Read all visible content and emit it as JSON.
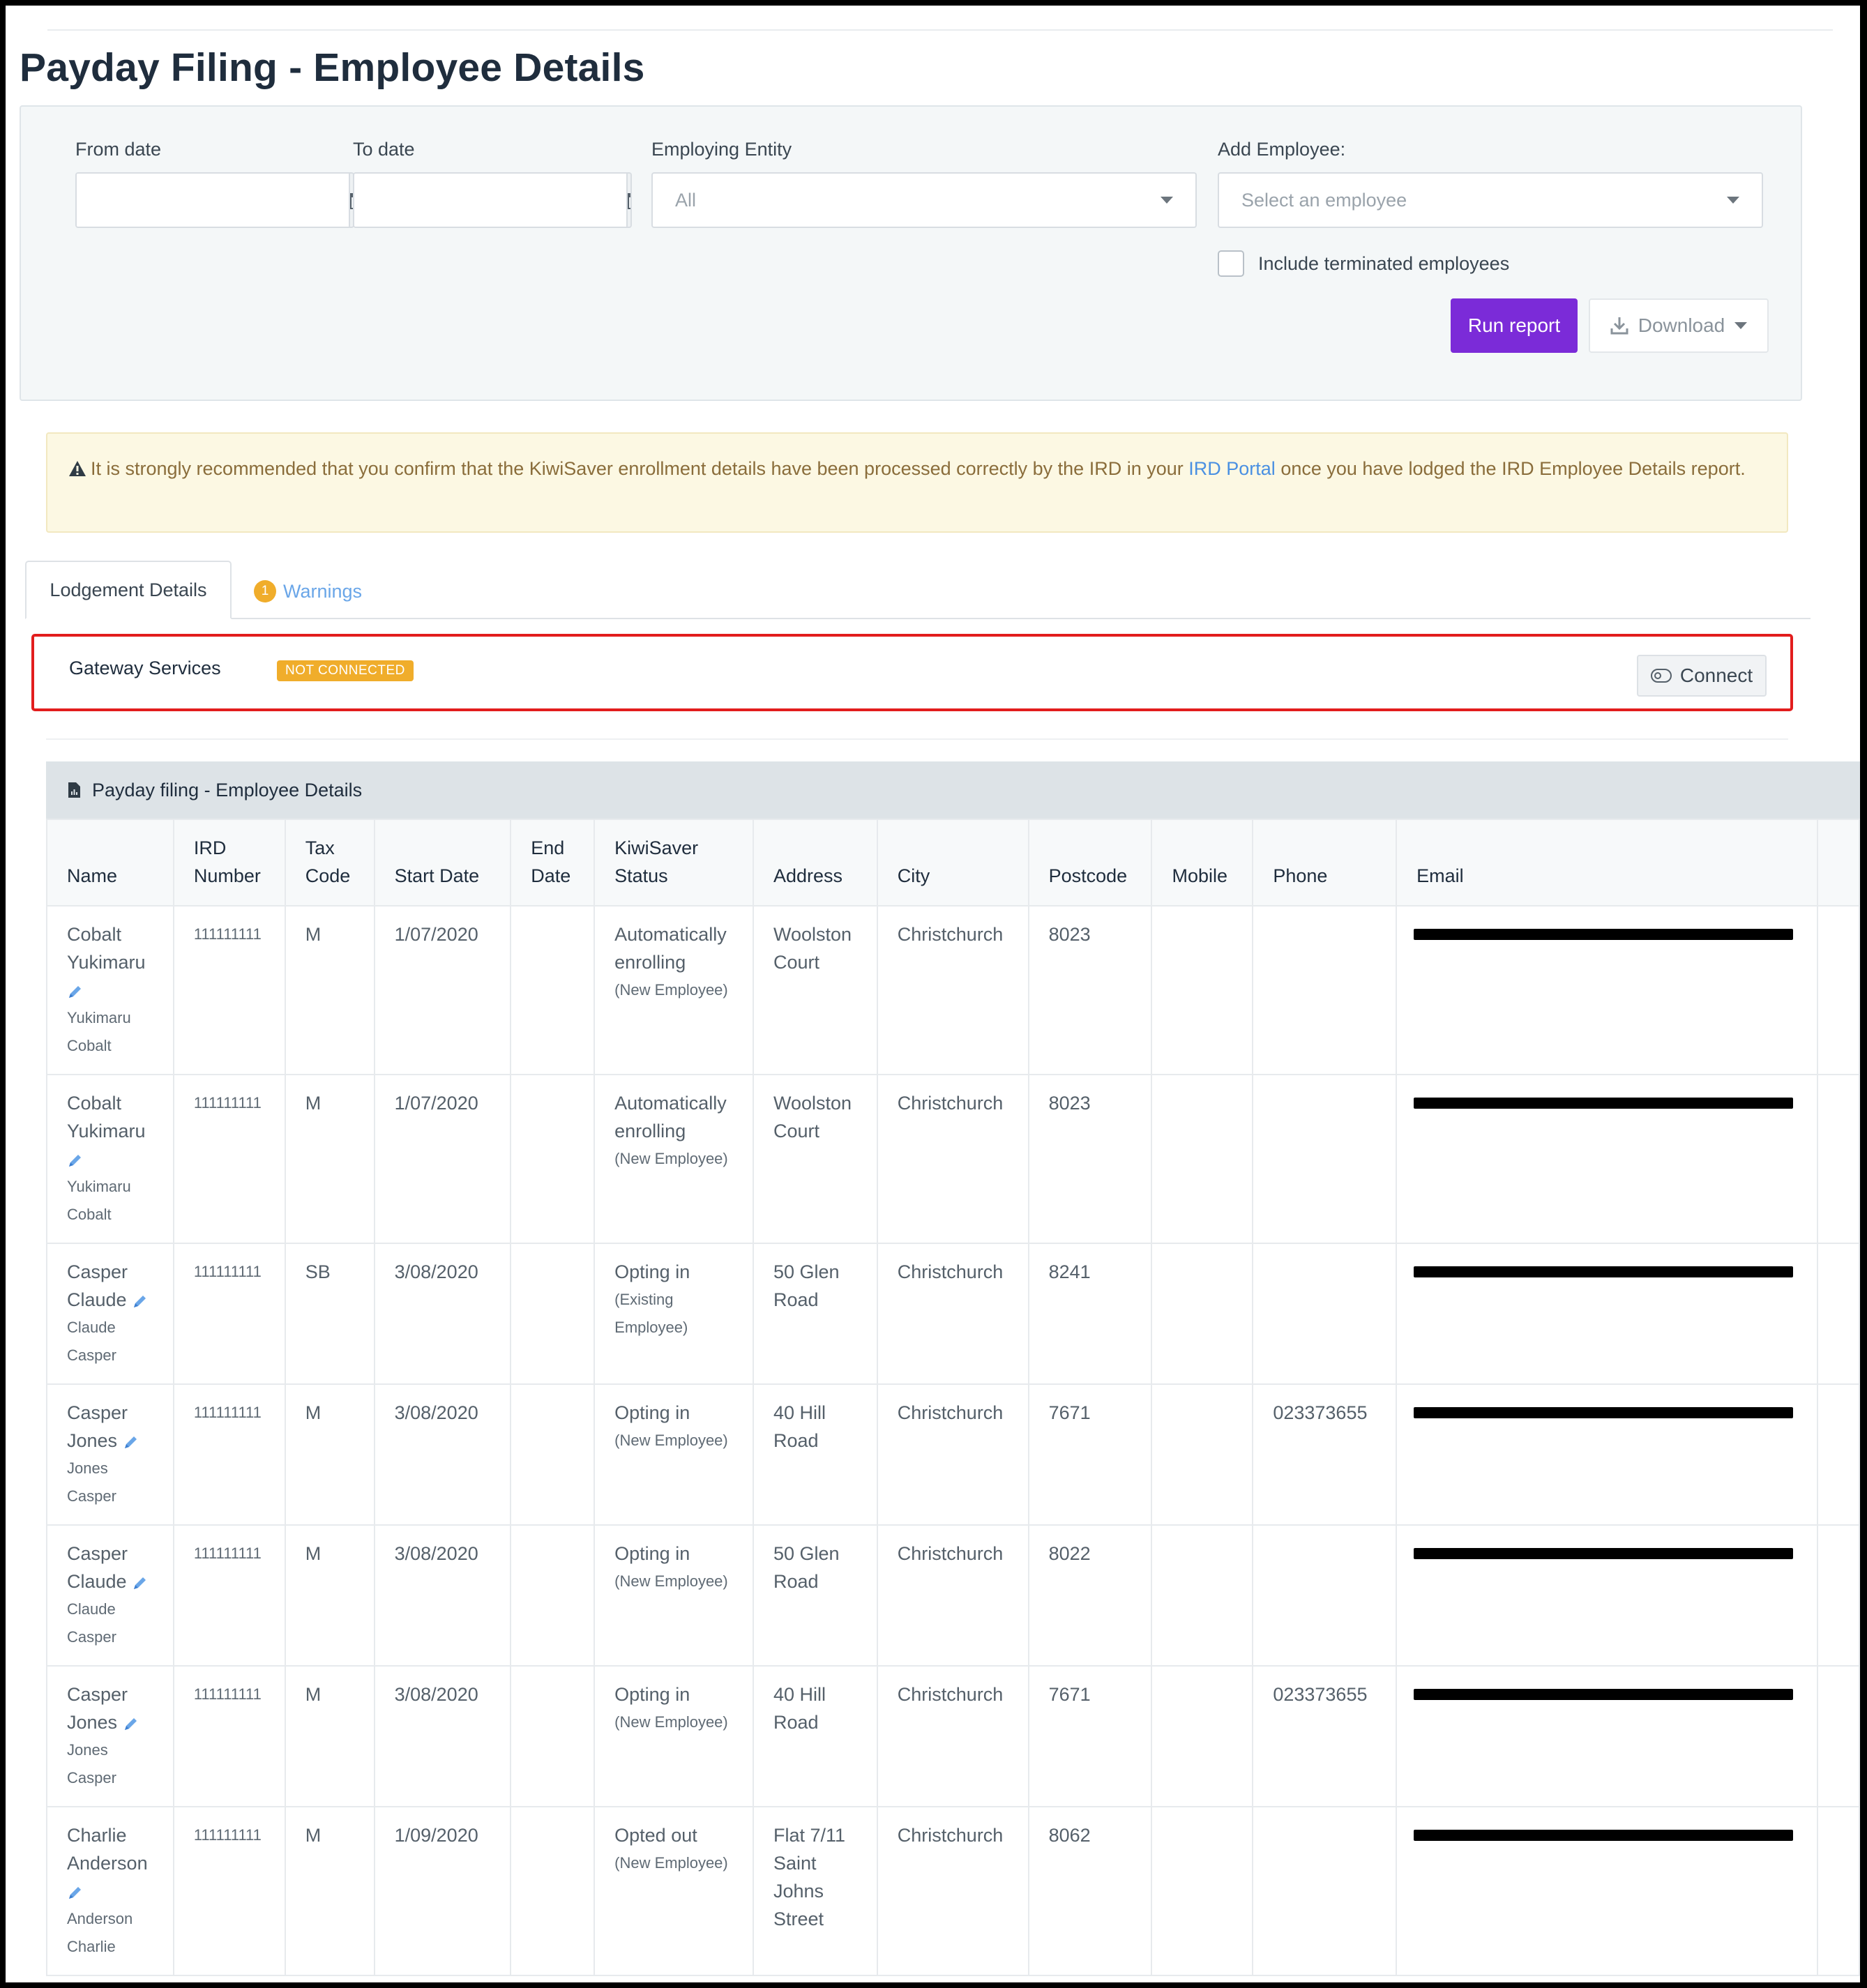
{
  "page": {
    "title": "Payday Filing - Employee Details"
  },
  "filters": {
    "from_label": "From date",
    "from_value": "",
    "to_label": "To date",
    "to_value": "",
    "entity_label": "Employing Entity",
    "entity_value": "All",
    "employee_label": "Add Employee:",
    "employee_placeholder": "Select an employee",
    "include_terminated_label": "Include terminated employees",
    "include_terminated_checked": false,
    "run_label": "Run report",
    "download_label": "Download",
    "accent_color": "#7b2bd8"
  },
  "alert": {
    "text_before": "It is strongly recommended that you confirm that the KiwiSaver enrollment details have been processed correctly by the IRD in your",
    "link_text": "IRD Portal",
    "text_after": "once you have lodged the IRD Employee Details report."
  },
  "tabs": {
    "lodgement": "Lodgement Details",
    "warnings": "Warnings",
    "warnings_count": "1"
  },
  "gateway": {
    "title": "Gateway Services",
    "status": "NOT CONNECTED",
    "connect_label": "Connect"
  },
  "report": {
    "title": "Payday filing - Employee Details",
    "columns": {
      "name": "Name",
      "ird": "IRD Number",
      "tax": "Tax Code",
      "start": "Start Date",
      "end": "End Date",
      "kiwi": "KiwiSaver Status",
      "address": "Address",
      "city": "City",
      "postcode": "Postcode",
      "mobile": "Mobile",
      "phone": "Phone",
      "email": "Email"
    },
    "rows": [
      {
        "name": "Cobalt Yukimaru",
        "alt": "Yukimaru Cobalt",
        "ird": "111111111",
        "tax": "M",
        "start": "1/07/2020",
        "end": "",
        "kiwi": "Automatically enrolling",
        "kiwi_note": "(New Employee)",
        "address": "Woolston Court",
        "city": "Christchurch",
        "postcode": "8023",
        "mobile": "",
        "phone": ""
      },
      {
        "name": "Cobalt Yukimaru",
        "alt": "Yukimaru Cobalt",
        "ird": "111111111",
        "tax": "M",
        "start": "1/07/2020",
        "end": "",
        "kiwi": "Automatically enrolling",
        "kiwi_note": "(New Employee)",
        "address": "Woolston Court",
        "city": "Christchurch",
        "postcode": "8023",
        "mobile": "",
        "phone": ""
      },
      {
        "name": "Casper Claude",
        "alt": "Claude Casper",
        "ird": "111111111",
        "tax": "SB",
        "start": "3/08/2020",
        "end": "",
        "kiwi": "Opting in",
        "kiwi_note": "(Existing Employee)",
        "address": "50 Glen Road",
        "city": "Christchurch",
        "postcode": "8241",
        "mobile": "",
        "phone": ""
      },
      {
        "name": "Casper Jones",
        "alt": "Jones Casper",
        "ird": "111111111",
        "tax": "M",
        "start": "3/08/2020",
        "end": "",
        "kiwi": "Opting in",
        "kiwi_note": "(New Employee)",
        "address": "40 Hill Road",
        "city": "Christchurch",
        "postcode": "7671",
        "mobile": "",
        "phone": "023373655"
      },
      {
        "name": "Casper Claude",
        "alt": "Claude Casper",
        "ird": "111111111",
        "tax": "M",
        "start": "3/08/2020",
        "end": "",
        "kiwi": "Opting in",
        "kiwi_note": "(New Employee)",
        "address": "50 Glen Road",
        "city": "Christchurch",
        "postcode": "8022",
        "mobile": "",
        "phone": ""
      },
      {
        "name": "Casper Jones",
        "alt": "Jones Casper",
        "ird": "111111111",
        "tax": "M",
        "start": "3/08/2020",
        "end": "",
        "kiwi": "Opting in",
        "kiwi_note": "(New Employee)",
        "address": "40 Hill Road",
        "city": "Christchurch",
        "postcode": "7671",
        "mobile": "",
        "phone": "023373655"
      },
      {
        "name": "Charlie Anderson",
        "alt": "Anderson Charlie",
        "ird": "111111111",
        "tax": "M",
        "start": "1/09/2020",
        "end": "",
        "kiwi": "Opted out",
        "kiwi_note": "(New Employee)",
        "address": "Flat 7/11 Saint Johns Street",
        "city": "Christchurch",
        "postcode": "8062",
        "mobile": "",
        "phone": ""
      }
    ]
  }
}
